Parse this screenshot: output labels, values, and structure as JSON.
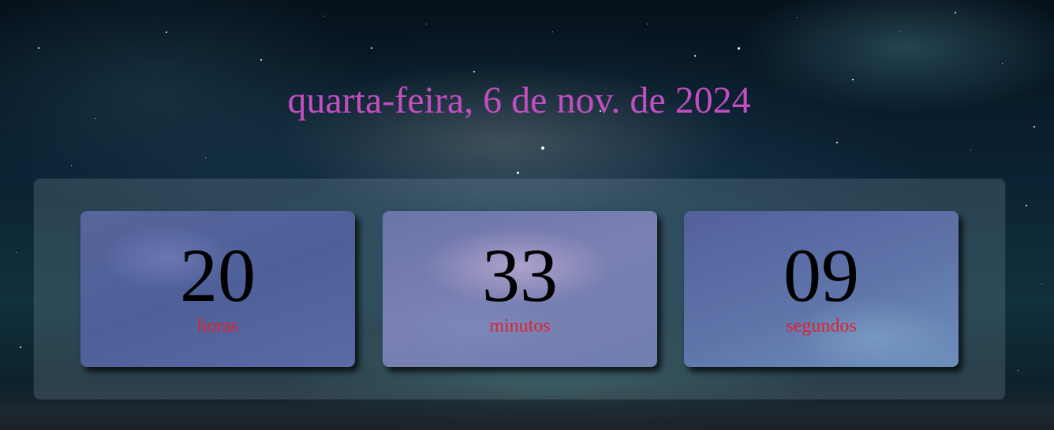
{
  "header": {
    "date_text": "quarta-feira, 6 de nov. de 2024"
  },
  "clock": {
    "hours": {
      "value": "20",
      "label": "horas"
    },
    "minutes": {
      "value": "33",
      "label": "minutos"
    },
    "seconds": {
      "value": "09",
      "label": "segundos"
    }
  },
  "colors": {
    "date_text": "#c24fc0",
    "number_text": "#000000",
    "unit_text": "#e0202f"
  }
}
